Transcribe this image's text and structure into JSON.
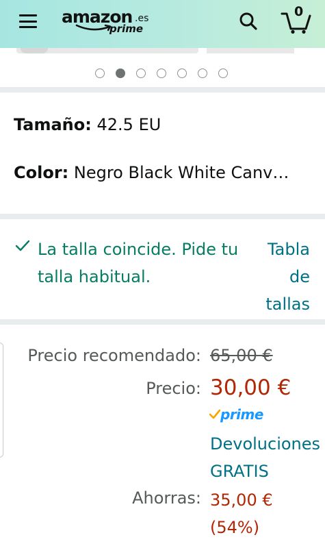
{
  "header": {
    "logo_main": "amazon",
    "logo_tld": ".es",
    "logo_sub": "prime",
    "cart_count": "0"
  },
  "gallery": {
    "dot_count": 7,
    "active_index": 1
  },
  "variation": {
    "size_label": "Tamaño:",
    "size_value": "42.5 EU",
    "color_label": "Color:",
    "color_value": "Negro Black White Canv…"
  },
  "fit": {
    "message": "La talla coincide. Pide tu talla habitual.",
    "size_chart_link": "Tabla de tallas"
  },
  "price": {
    "rrp_label": "Precio recomendado:",
    "rrp_value": "65,00 €",
    "price_label": "Precio:",
    "price_value": "30,00 €",
    "prime_label": "prime",
    "returns_line1": "Devoluciones",
    "returns_line2": "GRATIS",
    "savings_label": "Ahorras:",
    "savings_value": "35,00 €",
    "savings_percent": "(54%)"
  },
  "colors": {
    "header_start": "#a6e6e1",
    "header_end": "#c6efd6",
    "price_red": "#b12704",
    "link_teal": "#007185",
    "fit_green": "#067d62",
    "prime_blue": "#1a98ff",
    "prime_check": "#f7a600"
  },
  "icons": {
    "menu": "hamburger-menu-icon",
    "search": "search-icon",
    "cart": "cart-icon",
    "check": "checkmark-icon"
  }
}
